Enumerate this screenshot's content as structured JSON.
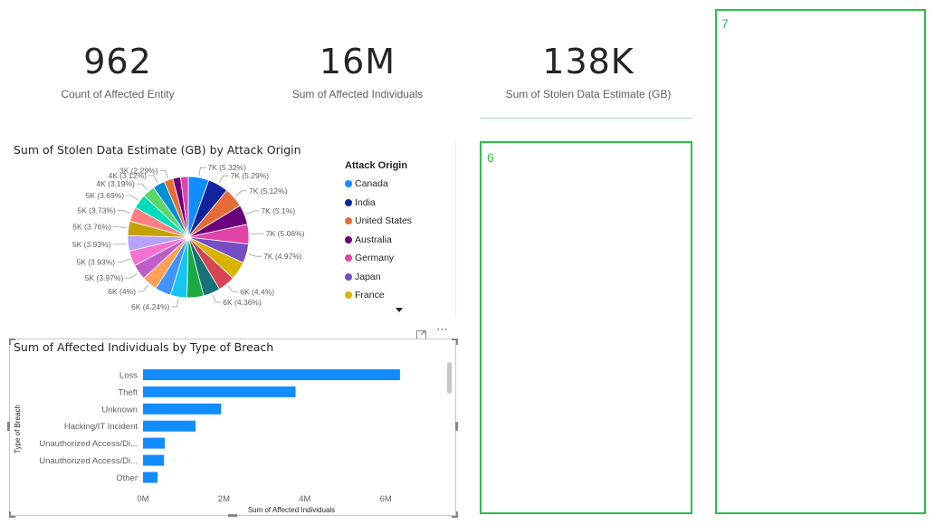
{
  "cards": [
    {
      "value": "962",
      "label": "Count of Affected Entity"
    },
    {
      "value": "16M",
      "label": "Sum of Affected Individuals"
    },
    {
      "value": "138K",
      "label": "Sum of Stolen Data Estimate (GB)"
    }
  ],
  "placeholders": [
    {
      "number": "6"
    },
    {
      "number": "7"
    }
  ],
  "pie_visual": {
    "title": "Sum of Stolen Data Estimate (GB) by Attack Origin",
    "legend_title": "Attack Origin",
    "legend": [
      {
        "name": "Canada",
        "color": "#118dff"
      },
      {
        "name": "India",
        "color": "#12239e"
      },
      {
        "name": "United States",
        "color": "#e66c37"
      },
      {
        "name": "Australia",
        "color": "#6b007b"
      },
      {
        "name": "Germany",
        "color": "#e044a7"
      },
      {
        "name": "Japan",
        "color": "#744ec2"
      },
      {
        "name": "France",
        "color": "#d9b300"
      }
    ],
    "more_icon": "caret-down-icon"
  },
  "bar_visual": {
    "title": "Sum of Affected Individuals by Type of Breach",
    "header_icons": [
      "focus-mode-icon",
      "more-options-icon"
    ]
  },
  "chart_data": [
    {
      "type": "pie",
      "title": "Sum of Stolen Data Estimate (GB) by Attack Origin",
      "legend_title": "Attack Origin",
      "legend_position": "right",
      "slices": [
        {
          "label": "7K (5.32%)",
          "percent": 5.32,
          "color": "#118dff"
        },
        {
          "label": "7K (5.29%)",
          "percent": 5.29,
          "color": "#12239e"
        },
        {
          "label": "7K (5.12%)",
          "percent": 5.12,
          "color": "#e66c37"
        },
        {
          "label": "7K (5.1%)",
          "percent": 5.1,
          "color": "#6b007b"
        },
        {
          "label": "7K (5.06%)",
          "percent": 5.06,
          "color": "#e044a7"
        },
        {
          "label": "7K (4.97%)",
          "percent": 4.97,
          "color": "#744ec2"
        },
        {
          "label": "",
          "percent": 4.7,
          "color": "#d9b300"
        },
        {
          "label": "6K (4.4%)",
          "percent": 4.4,
          "color": "#d64550"
        },
        {
          "label": "6K (4.36%)",
          "percent": 4.36,
          "color": "#197278"
        },
        {
          "label": "",
          "percent": 4.3,
          "color": "#1aab40"
        },
        {
          "label": "6K (4.24%)",
          "percent": 4.24,
          "color": "#15c6f4"
        },
        {
          "label": "",
          "percent": 4.1,
          "color": "#4092ff"
        },
        {
          "label": "6K (4%)",
          "percent": 4.0,
          "color": "#ffa058"
        },
        {
          "label": "5K (3.97%)",
          "percent": 3.97,
          "color": "#be5dc9"
        },
        {
          "label": "5K (3.93%)",
          "percent": 3.93,
          "color": "#f472d0"
        },
        {
          "label": "5K (3.93%)",
          "percent": 3.93,
          "color": "#b5a1ff"
        },
        {
          "label": "5K (3.76%)",
          "percent": 3.76,
          "color": "#c4a200"
        },
        {
          "label": "5K (3.73%)",
          "percent": 3.73,
          "color": "#ff8080"
        },
        {
          "label": "5K (3.69%)",
          "percent": 3.69,
          "color": "#00dbbc"
        },
        {
          "label": "4K (3.19%)",
          "percent": 3.19,
          "color": "#5bd667"
        },
        {
          "label": "4K (3.12%)",
          "percent": 3.12,
          "color": "#0091d5"
        },
        {
          "label": "3K (2.29%)",
          "percent": 2.29,
          "color": "#e66c37"
        },
        {
          "label": "",
          "percent": 2.0,
          "color": "#6b007b"
        },
        {
          "label": "",
          "percent": 1.98,
          "color": "#e044a7"
        }
      ]
    },
    {
      "type": "bar",
      "orientation": "horizontal",
      "title": "Sum of Affected Individuals by Type of Breach",
      "xlabel": "Sum of Affected Individuals",
      "ylabel": "Type of Breach",
      "categories": [
        "Loss",
        "Theft",
        "Unknown",
        "Hacking/IT Incident",
        "Unauthorized Access/Di...",
        "Unauthorized Access/Di...",
        "Other"
      ],
      "values": [
        6350000,
        3770000,
        1930000,
        1300000,
        540000,
        520000,
        360000
      ],
      "xlim": [
        0,
        6800000
      ],
      "xticks": [
        {
          "value": 0,
          "label": "0M"
        },
        {
          "value": 2000000,
          "label": "2M"
        },
        {
          "value": 4000000,
          "label": "4M"
        },
        {
          "value": 6000000,
          "label": "6M"
        }
      ],
      "color": "#118dff",
      "grid": false
    }
  ]
}
